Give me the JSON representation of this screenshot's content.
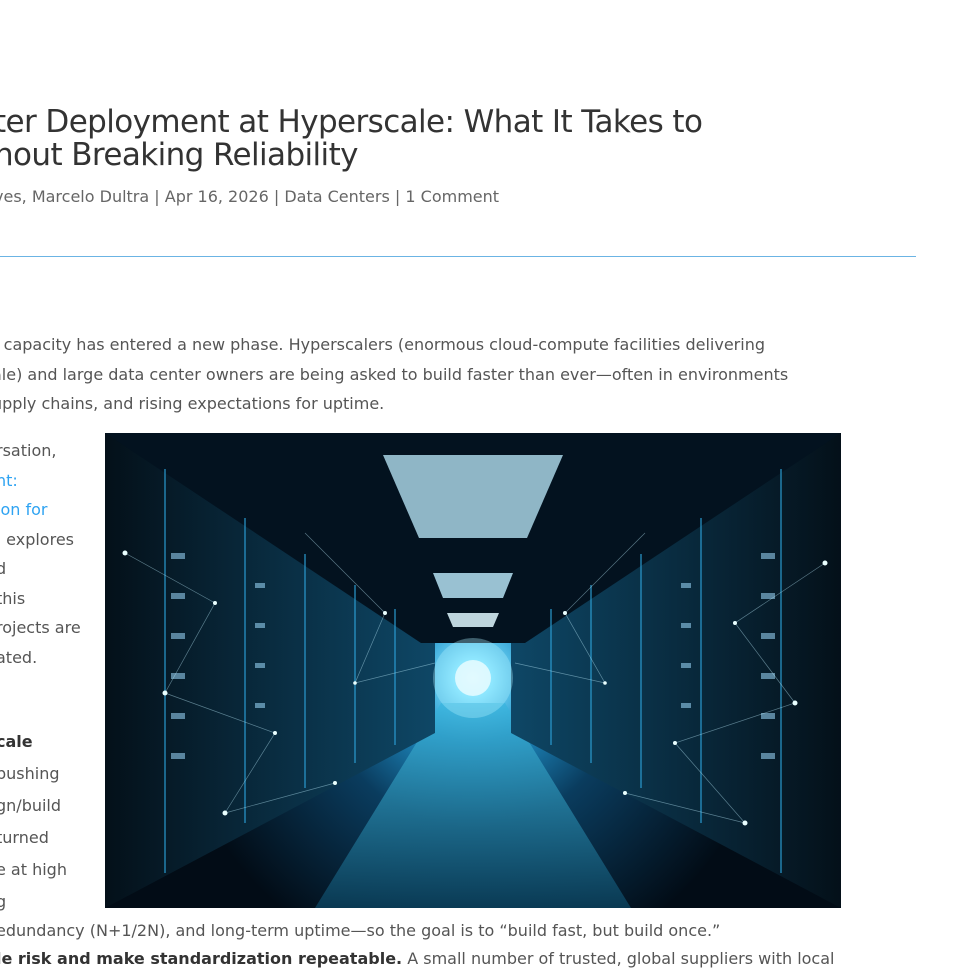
{
  "post": {
    "title_line1": "ter Deployment at Hyperscale: What It Takes to",
    "title_line2": "hout Breaking Reliability",
    "meta": {
      "authors": "ves, Marcelo Dultra",
      "date": "Apr 16, 2026",
      "category": "Data Centers",
      "comments": "1 Comment",
      "separator": " | "
    },
    "intro": [
      "r capacity has entered a new phase. Hyperscalers (enormous cloud-compute facilities delivering",
      "ale) and large data center owners are being asked to build faster than ever—often in environments",
      "upply chains, and rising expectations for uptime."
    ],
    "left_column": {
      "line1": "rsation,",
      "line2_link": "nt:",
      "line3_link": "ion for",
      "line4": ", explores",
      "line5": "d",
      "line6": "this",
      "line7": "rojects are",
      "line8": "ated."
    },
    "section": {
      "heading": "cale",
      "line1": "pushing",
      "line2": "gn/build",
      "line3": "turned",
      "line4": "e at high",
      "line5": "g"
    },
    "after_image_line": "edundancy (N+1/2N), and long-term uptime—so the goal is to “build fast, but build once.”",
    "next_line_bold": "le risk and make standardization repeatable.",
    "next_line_rest": " A small number of trusted, global suppliers with local"
  },
  "image": {
    "alt_icon": "data-center-corridor-image",
    "accent": "#39c4ff"
  },
  "colors": {
    "divider": "#6bb4e4",
    "link": "#2ea3f2",
    "title": "#333333",
    "body": "#555555"
  }
}
